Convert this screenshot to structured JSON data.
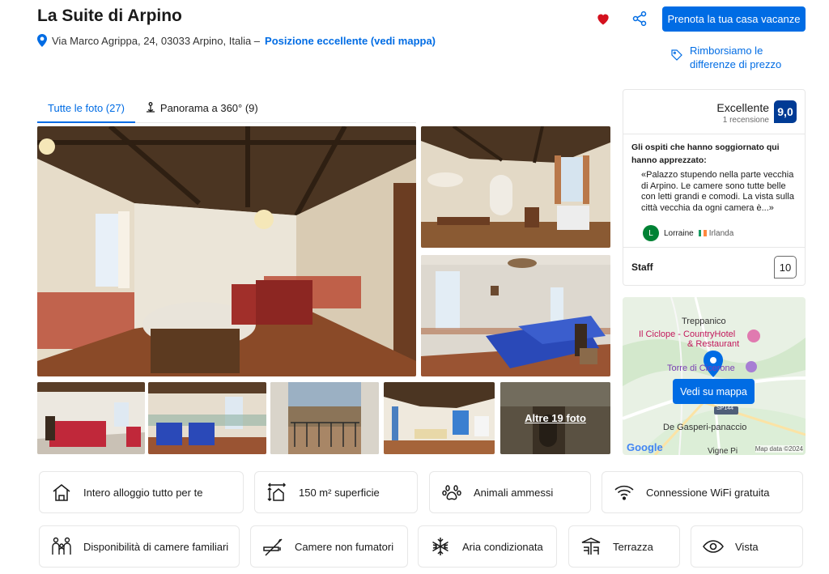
{
  "header": {
    "title": "La Suite di Arpino",
    "address": "Via Marco Agrippa, 24, 03033 Arpino, Italia –",
    "location_link": "Posizione eccellente (vedi mappa)",
    "book_button": "Prenota la tua casa vacanze",
    "refund_text": "Rimborsiamo le differenze di prezzo",
    "icons": [
      "map-pin-icon",
      "heart-icon",
      "share-icon",
      "price-tag-icon"
    ]
  },
  "tabs": [
    {
      "label": "Tutte le foto (27)",
      "active": true
    },
    {
      "label": "Panorama a 360° (9)",
      "active": false
    }
  ],
  "gallery": {
    "more_label": "Altre 19 foto"
  },
  "review": {
    "rating_word": "Excellente",
    "reviews_count": "1 recensione",
    "score": "9,0",
    "intro": "Gli ospiti che hanno soggiornato qui hanno apprezzato:",
    "quote": "«Palazzo stupendo nella parte vecchia di Arpino. Le camere sono tutte belle con letti grandi e comodi. La vista sulla città vecchia da ogni camera è...»",
    "user_initial": "L",
    "user_name": "Lorraine",
    "user_country": "Irlanda",
    "staff_label": "Staff",
    "staff_score": "10"
  },
  "map": {
    "labels": [
      "Treppanico",
      "Il Ciclope - CountryHotel",
      "& Restaurant",
      "Torre di Cicerone",
      "SP144",
      "De Gasperi-panaccio",
      "Vigne Pi"
    ],
    "button": "Vedi su mappa",
    "google": "Google",
    "map_data": "Map data ©2024"
  },
  "facilities": [
    {
      "label": "Intero alloggio tutto per te",
      "icon": "house-icon"
    },
    {
      "label": "150 m² superficie",
      "icon": "floor-area-icon"
    },
    {
      "label": "Animali ammessi",
      "icon": "paw-icon"
    },
    {
      "label": "Connessione WiFi gratuita",
      "icon": "wifi-icon"
    },
    {
      "label": "Disponibilità di camere familiari",
      "icon": "family-icon"
    },
    {
      "label": "Camere non fumatori",
      "icon": "no-smoking-icon"
    },
    {
      "label": "Aria condizionata",
      "icon": "snowflake-icon"
    },
    {
      "label": "Terrazza",
      "icon": "terrace-icon"
    },
    {
      "label": "Vista",
      "icon": "eye-icon"
    }
  ]
}
